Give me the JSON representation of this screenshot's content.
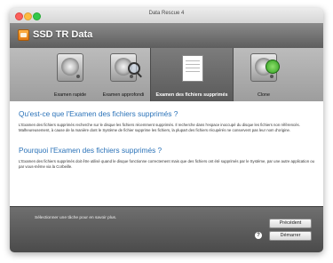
{
  "window": {
    "title": "Data Rescue 4"
  },
  "header": {
    "app_name": "SSD TR Data"
  },
  "toolbar": {
    "items": [
      {
        "label": "Examen rapide",
        "icon": "hard-drive-icon"
      },
      {
        "label": "Examen approfondi",
        "icon": "hard-drive-magnifier-icon"
      },
      {
        "label": "Examen des fichiers supprimés",
        "icon": "deleted-files-icon",
        "selected": true
      },
      {
        "label": "Clone",
        "icon": "clone-drive-icon"
      }
    ]
  },
  "content": {
    "heading1": "Qu'est-ce que l'Examen des fichiers supprimés ?",
    "paragraph1": "L'Examen des fichiers supprimés recherche sur le disque les fichiers récemment supprimés. Il recherche dans l'espace inoccupé du disque les fichiers non référencés. Malheureusement, à cause de la manière dont le Système de fichier supprime les fichiers, la plupart des fichiers récupérés ne conservent pas leur nom d'origine.",
    "heading2": "Pourquoi l'Examen des fichiers supprimés ?",
    "paragraph2": "L'Examen des fichiers supprimés doit être utilisé quand le disque fonctionne correctement mais que des fichiers ont été supprimés par le Système, par une autre application ou par vous-même via la Corbeille."
  },
  "footer": {
    "status": "Sélectionner une tâche pour en savoir plus.",
    "help_label": "?",
    "previous_label": "Précédent",
    "start_label": "Démarrer"
  },
  "colors": {
    "heading": "#2a72b8",
    "header_bg": "#6e6e6e",
    "footer_bg": "#555555"
  }
}
